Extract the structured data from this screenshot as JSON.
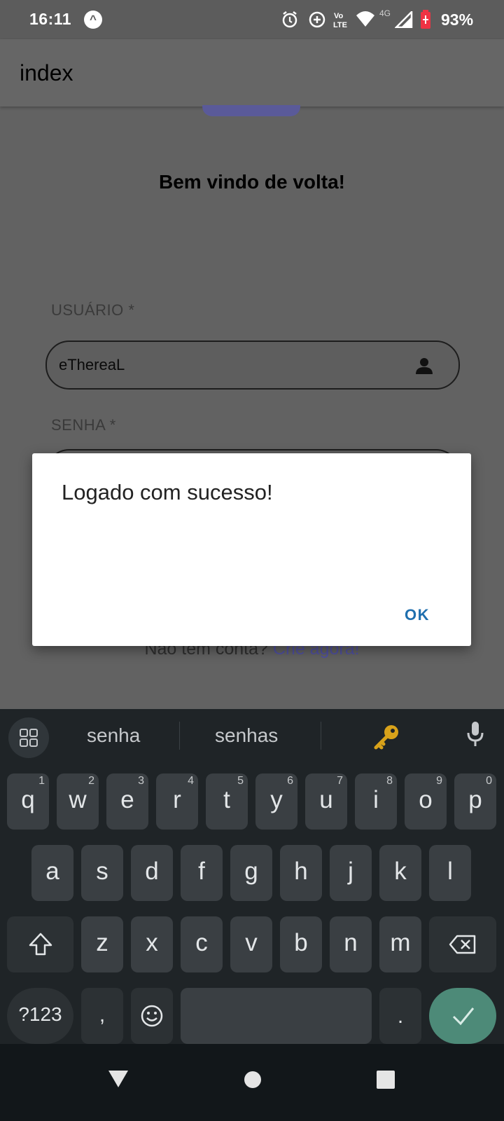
{
  "status_bar": {
    "time": "16:11",
    "battery_percent": "93%",
    "network": "4G"
  },
  "app_bar": {
    "title": "index"
  },
  "page": {
    "welcome": "Bem vindo de volta!",
    "username_label": "USUÁRIO *",
    "username_value": "eThereaL",
    "password_label": "SENHA *",
    "no_account_text": "Não tem conta?",
    "create_link": "Crie agora!"
  },
  "dialog": {
    "message": "Logado com sucesso!",
    "ok_label": "OK"
  },
  "keyboard": {
    "suggestions": [
      "senha",
      "senhas"
    ],
    "row1": [
      [
        "q",
        "1"
      ],
      [
        "w",
        "2"
      ],
      [
        "e",
        "3"
      ],
      [
        "r",
        "4"
      ],
      [
        "t",
        "5"
      ],
      [
        "y",
        "6"
      ],
      [
        "u",
        "7"
      ],
      [
        "i",
        "8"
      ],
      [
        "o",
        "9"
      ],
      [
        "p",
        "0"
      ]
    ],
    "row2": [
      "a",
      "s",
      "d",
      "f",
      "g",
      "h",
      "j",
      "k",
      "l"
    ],
    "row3": [
      "z",
      "x",
      "c",
      "v",
      "b",
      "n",
      "m"
    ],
    "symbols_label": "?123",
    "comma": ",",
    "period": "."
  },
  "colors": {
    "dialog_ok": "#1f6fae",
    "enter_key": "#4d8a78",
    "link": "#4f4fa0"
  }
}
